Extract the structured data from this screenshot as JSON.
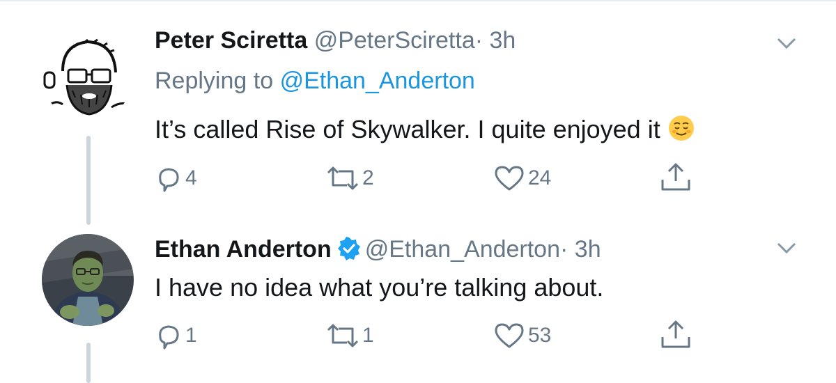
{
  "colors": {
    "text": "#14171a",
    "secondary": "#657786",
    "link": "#1b95e0",
    "verified": "#1da1f2",
    "thread_line": "#ccd6dd"
  },
  "tweets": [
    {
      "author_name": "Peter Sciretta",
      "handle": "@PeterSciretta",
      "separator": "·",
      "time": "3h",
      "verified": false,
      "replying_label": "Replying to",
      "replying_to": "@Ethan_Anderton",
      "text": "It’s called Rise of Skywalker. I quite enjoyed it",
      "emoji": "relieved-smile-emoji",
      "actions": {
        "reply_count": "4",
        "retweet_count": "2",
        "like_count": "24"
      },
      "avatar": "sketch-portrait-avatar"
    },
    {
      "author_name": "Ethan Anderton",
      "handle": "@Ethan_Anderton",
      "separator": "·",
      "time": "3h",
      "verified": true,
      "text": "I have no idea what you’re talking about.",
      "actions": {
        "reply_count": "1",
        "retweet_count": "1",
        "like_count": "53"
      },
      "avatar": "hulk-photo-avatar"
    }
  ],
  "icons": [
    "reply-icon",
    "retweet-icon",
    "like-icon",
    "share-icon",
    "chevron-down-icon",
    "verified-badge-icon"
  ]
}
